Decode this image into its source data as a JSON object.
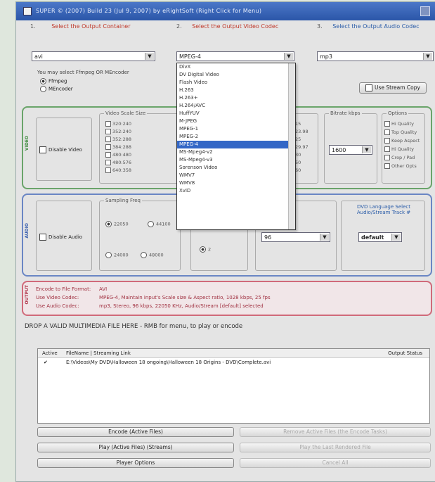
{
  "window": {
    "title": "SUPER © (2007) Build 23 (Jul 9, 2007) by eRightSoft (Right Click for Menu)"
  },
  "steps": {
    "step1": {
      "num": "1.",
      "label": "Select the Output Container"
    },
    "step2": {
      "num": "2.",
      "label": "Select the Output Video Codec"
    },
    "step3": {
      "num": "3.",
      "label": "Select the Output Audio Codec"
    }
  },
  "selects": {
    "container": "avi",
    "video_codec": "MPEG-4",
    "audio_codec": "mp3"
  },
  "ffmpeg": {
    "hint": "You may select Ffmpeg OR MEncoder",
    "ffmpeg_label": "Ffmpeg",
    "mencoder_label": "MEncoder"
  },
  "stream_copy": "Use Stream Copy",
  "codec_list": {
    "items": [
      "DivX",
      "DV Digital Video",
      "Flash Video",
      "H.263",
      "H.263+",
      "H.264/AVC",
      "HuffYUV",
      "M-JPEG",
      "MPEG-1",
      "MPEG-2",
      "MPEG-4",
      "MS-Mpeg4-v2",
      "MS-Mpeg4-v3",
      "Sorenson Video",
      "WMV7",
      "WMV8",
      "XviD"
    ],
    "selected_index": 10
  },
  "video": {
    "section_label": "VIDEO",
    "disable_label": "Disable Video",
    "scale_title": "Video Scale Size",
    "sizes": [
      "320:240",
      "352:240",
      "352:288",
      "384:288",
      "480:480",
      "480:576",
      "640:358"
    ],
    "fps": [
      "15",
      "23.98",
      "25",
      "29.97",
      "30",
      "50",
      "60"
    ],
    "bitrate_title": "Bitrate kbps",
    "bitrate": "1600",
    "options_title": "Options",
    "options": [
      "Hi Quality",
      "Top Quality",
      "Keep Aspect",
      "Hi Quality",
      "Crop / Pad",
      "Other Opts"
    ]
  },
  "audio": {
    "section_label": "AUDIO",
    "disable_label": "Disable Audio",
    "freq_title": "Sampling Freq",
    "freqs": [
      "22050",
      "44100",
      "24000",
      "48000"
    ],
    "channels": "2",
    "bitrate": "96",
    "dvd_title": "DVD Language Select Audio/Stream Track #",
    "dvd_value": "default"
  },
  "output": {
    "section_label": "OUTPUT",
    "rows": [
      {
        "label": "Encode to File Format:",
        "value": "AVI"
      },
      {
        "label": "Use Video Codec:",
        "value": "MPEG-4, Maintain input's Scale size & Aspect ratio, 1028 kbps, 25 fps"
      },
      {
        "label": "Use Audio Codec:",
        "value": "mp3, Stereo, 96 kbps, 22050 KHz, Audio/Stream [default] selected"
      }
    ]
  },
  "drop_text": "DROP A VALID MULTIMEDIA FILE HERE - RMB for menu, to play or encode",
  "file_list": {
    "col_active": "Active",
    "col_filename": "FileName | Streaming Link",
    "col_status": "Output Status",
    "rows": [
      {
        "name": "E:\\Videos\\My DVD\\Halloween 18 ongoing\\Halloween 18 Origins - DVD\\Complete.avi"
      }
    ]
  },
  "buttons": {
    "encode": "Encode (Active Files)",
    "play": "Play (Active Files) (Streams)",
    "player_options": "Player Options",
    "right1": "Remove Active Files (the Encode Tasks)",
    "right2": "Play the Last Rendered File",
    "right3": "Cancel All"
  }
}
